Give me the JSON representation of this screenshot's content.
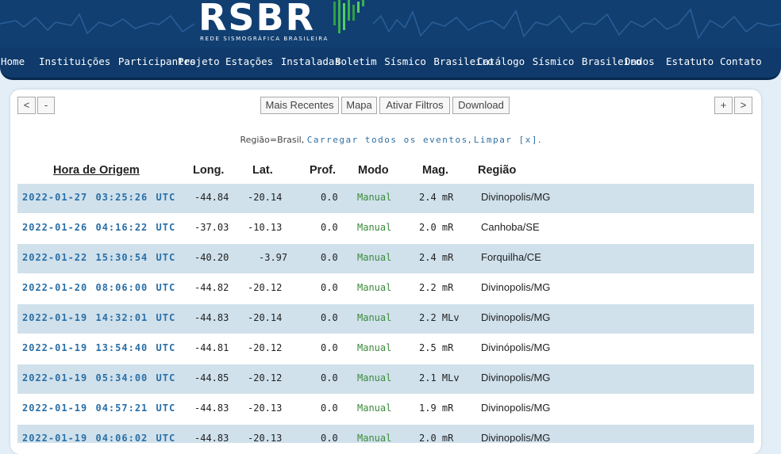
{
  "header": {
    "logo_text": "RSBR",
    "logo_subtitle": "REDE SISMOGRÁFICA BRASILEIRA"
  },
  "nav": {
    "items": [
      {
        "label": "Home"
      },
      {
        "label": "Instituições Participantes"
      },
      {
        "label": "Projeto"
      },
      {
        "label": "Estações Instaladas"
      },
      {
        "label": "Boletim Sísmico Brasileiro"
      },
      {
        "label": "Catálogo Sísmico Brasileiro"
      },
      {
        "label": "Dados"
      },
      {
        "label": "Estatuto"
      },
      {
        "label": "Contato"
      }
    ]
  },
  "toolbar": {
    "first": "<",
    "prev": "-",
    "recent": "Mais Recentes",
    "map": "Mapa",
    "filters": "Ativar Filtros",
    "download": "Download",
    "next": "+",
    "last": ">"
  },
  "filter": {
    "region": "Região=Brasil,",
    "load_all": "Carregar todos os eventos",
    "sep": ",",
    "clear": "Limpar [x]",
    "end": "."
  },
  "table": {
    "headers": {
      "time": "Hora de Origem",
      "lon": "Long.",
      "lat": "Lat.",
      "prof": "Prof.",
      "modo": "Modo",
      "mag": "Mag.",
      "regiao": "Região"
    },
    "rows": [
      {
        "time": "2022-01-27 03:25:26 UTC",
        "lon": "-44.84",
        "lat": "-20.14",
        "prof": "0.0",
        "modo": "Manual",
        "mag": "2.4 mR",
        "regiao": "Divinopolis/MG"
      },
      {
        "time": "2022-01-26 04:16:22 UTC",
        "lon": "-37.03",
        "lat": "-10.13",
        "prof": "0.0",
        "modo": "Manual",
        "mag": "2.0 mR",
        "regiao": "Canhoba/SE"
      },
      {
        "time": "2022-01-22 15:30:54 UTC",
        "lon": "-40.20",
        "lat": "-3.97",
        "prof": "0.0",
        "modo": "Manual",
        "mag": "2.4 mR",
        "regiao": "Forquilha/CE"
      },
      {
        "time": "2022-01-20 08:06:00 UTC",
        "lon": "-44.82",
        "lat": "-20.12",
        "prof": "0.0",
        "modo": "Manual",
        "mag": "2.2 mR",
        "regiao": "Divinopolis/MG"
      },
      {
        "time": "2022-01-19 14:32:01 UTC",
        "lon": "-44.83",
        "lat": "-20.14",
        "prof": "0.0",
        "modo": "Manual",
        "mag": "2.2 MLv",
        "regiao": "Divinopolis/MG"
      },
      {
        "time": "2022-01-19 13:54:40 UTC",
        "lon": "-44.81",
        "lat": "-20.12",
        "prof": "0.0",
        "modo": "Manual",
        "mag": "2.5 mR",
        "regiao": "Divinópolis/MG"
      },
      {
        "time": "2022-01-19 05:34:00 UTC",
        "lon": "-44.85",
        "lat": "-20.12",
        "prof": "0.0",
        "modo": "Manual",
        "mag": "2.1 MLv",
        "regiao": "Divinopolis/MG"
      },
      {
        "time": "2022-01-19 04:57:21 UTC",
        "lon": "-44.83",
        "lat": "-20.13",
        "prof": "0.0",
        "modo": "Manual",
        "mag": "1.9 mR",
        "regiao": "Divinopolis/MG"
      },
      {
        "time": "2022-01-19 04:06:02 UTC",
        "lon": "-44.83",
        "lat": "-20.13",
        "prof": "0.0",
        "modo": "Manual",
        "mag": "2.0 mR",
        "regiao": "Divinopolis/MG"
      }
    ]
  },
  "colors": {
    "header_bg": "#113f72",
    "row_alt": "#d0e1ec",
    "link": "#2a6fa6",
    "modo": "#3c8a3c",
    "logo_accent": "#37b24d"
  }
}
